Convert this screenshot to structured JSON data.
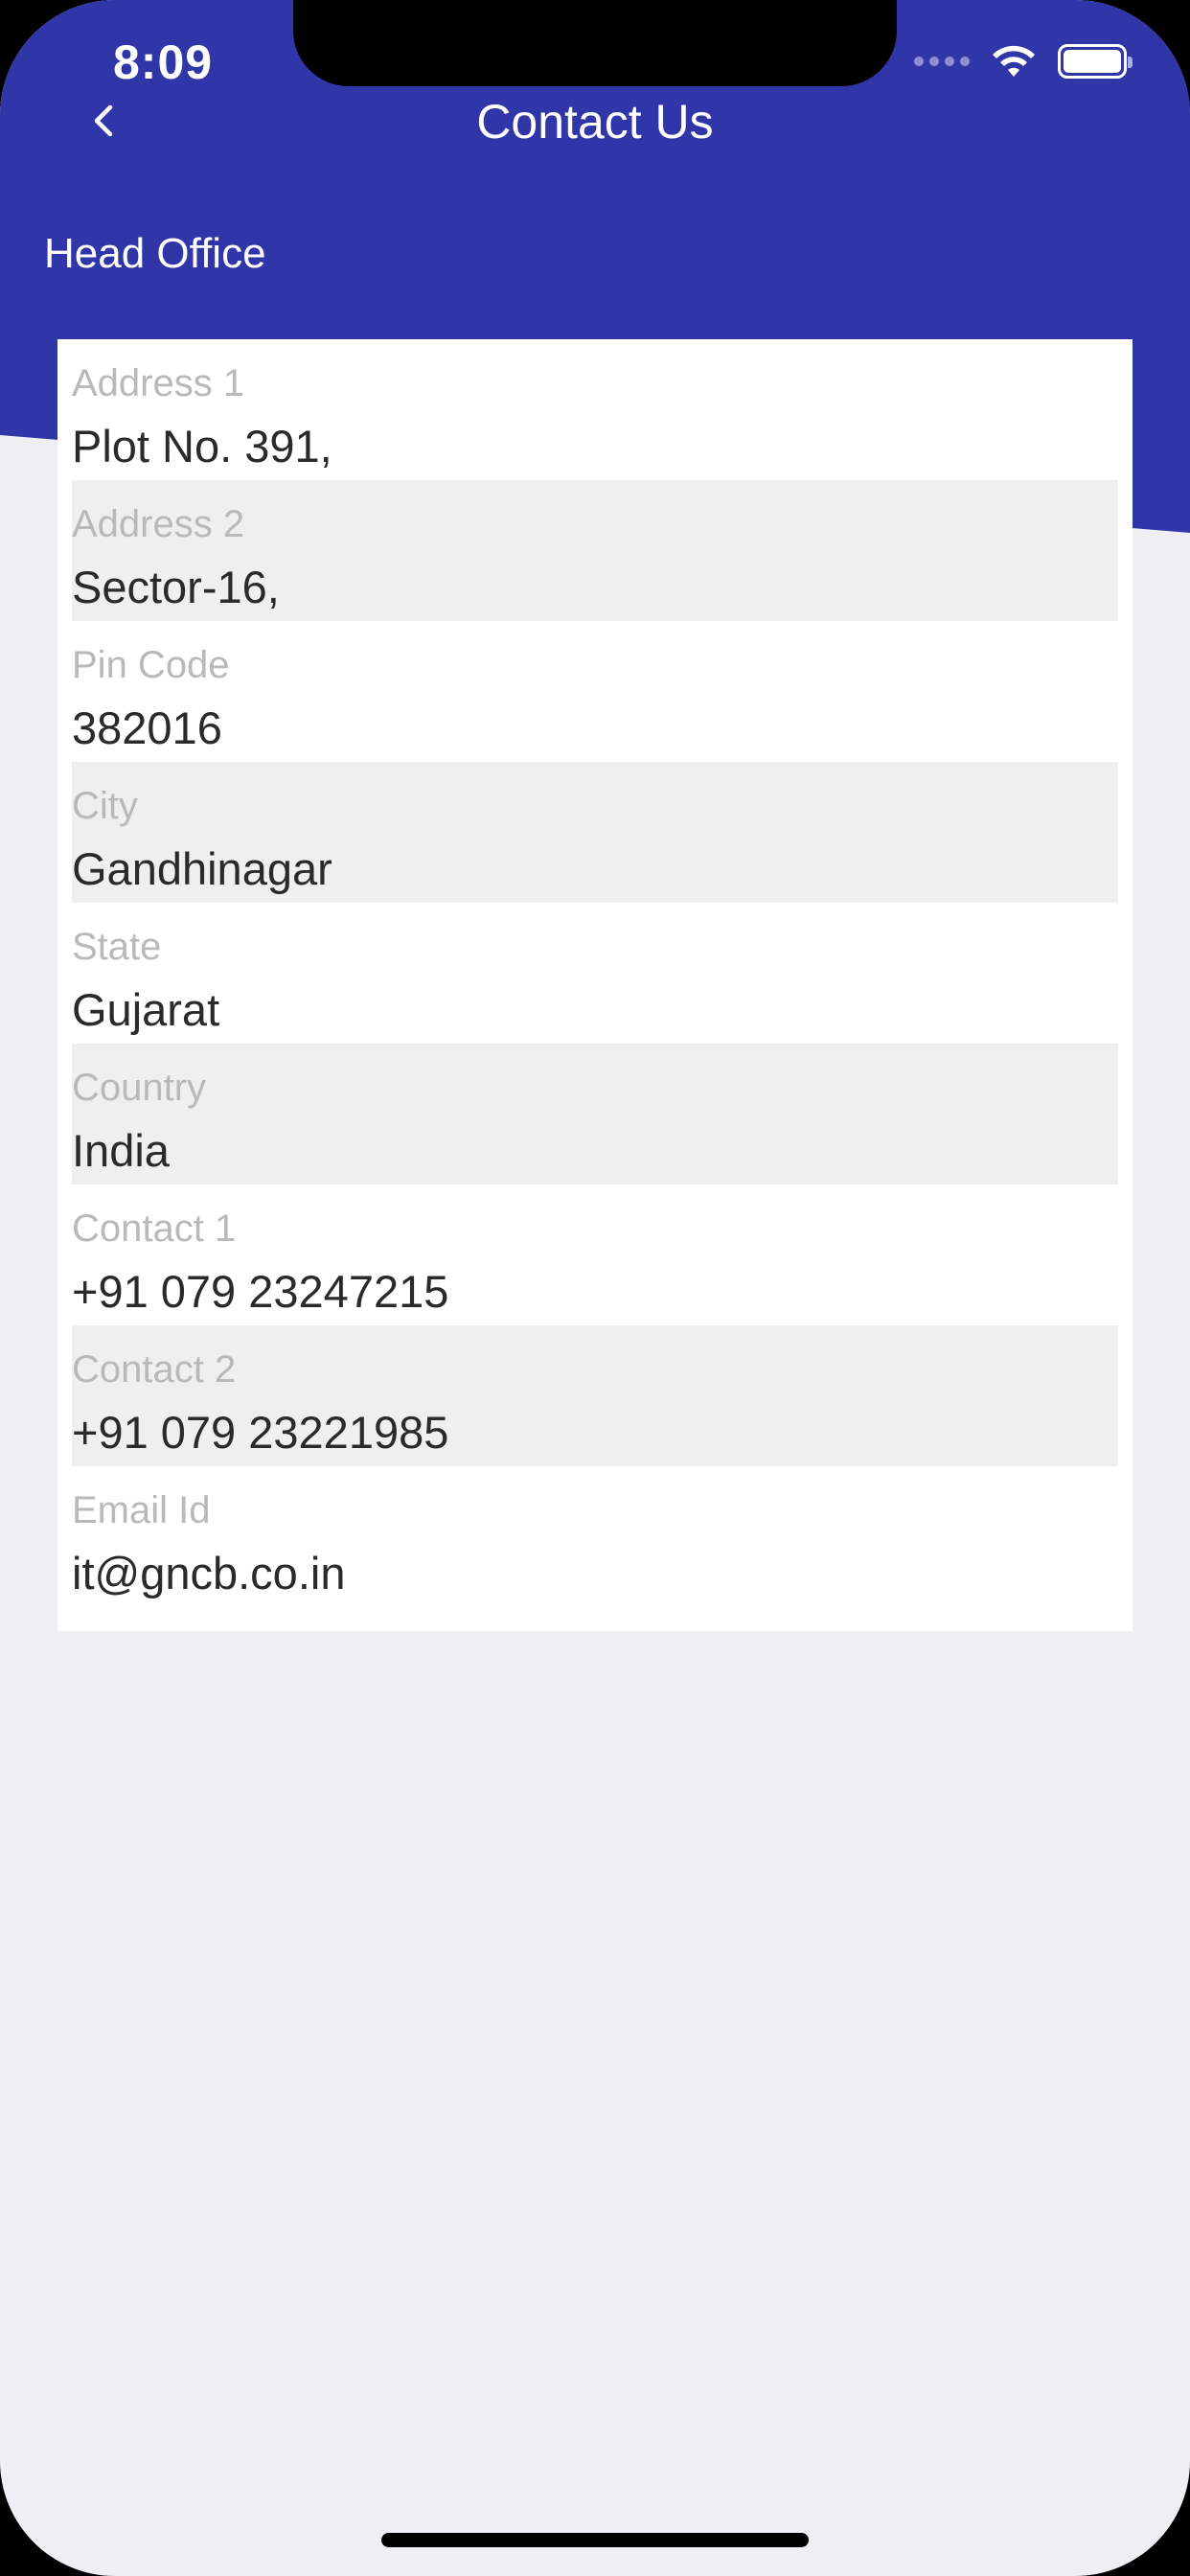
{
  "status_bar": {
    "time": "8:09",
    "wifi_icon": "wifi-icon",
    "battery_icon": "battery-icon"
  },
  "nav": {
    "back_icon": "chevron-left-icon",
    "title": "Contact Us"
  },
  "section": {
    "title": "Head Office"
  },
  "colors": {
    "header_blue": "#3035a8",
    "page_bg": "#efeef3",
    "row_alt": "#efeff0",
    "label_gray": "#b9b9bc",
    "value_text": "#2a2a2a"
  },
  "fields": [
    {
      "label": "Address 1",
      "value": "Plot No. 391,"
    },
    {
      "label": "Address 2",
      "value": "Sector-16,"
    },
    {
      "label": "Pin Code",
      "value": "382016"
    },
    {
      "label": "City",
      "value": "Gandhinagar"
    },
    {
      "label": "State",
      "value": "Gujarat"
    },
    {
      "label": "Country",
      "value": "India"
    },
    {
      "label": "Contact 1",
      "value": "+91 079 23247215"
    },
    {
      "label": "Contact 2",
      "value": "+91 079 23221985"
    },
    {
      "label": "Email Id",
      "value": "it@gncb.co.in"
    }
  ]
}
